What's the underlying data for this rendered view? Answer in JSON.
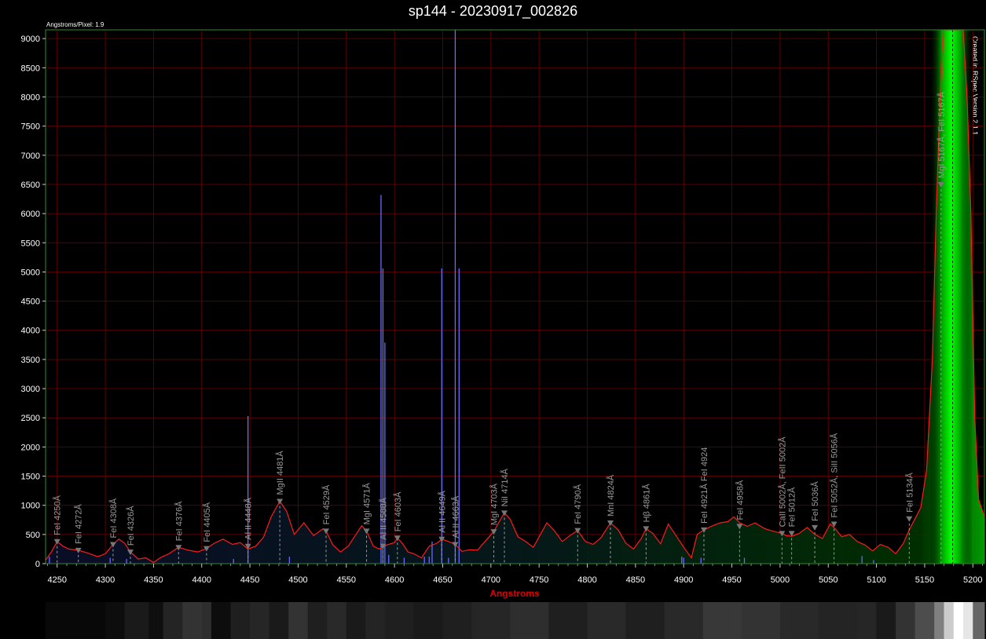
{
  "chart_data": {
    "type": "line",
    "title": "sp144 - 20230917_002826",
    "angstroms_per_pixel_note": "Angstroms/Pixel: 1.9",
    "software_note": "Created in RSpec Version 2.1.1",
    "xlabel": "Angstroms",
    "ylabel": "",
    "xlim": [
      4238,
      5212
    ],
    "ylim": [
      0,
      9150
    ],
    "grid": true,
    "x_ticks": [
      4250,
      4300,
      4350,
      4400,
      4450,
      4500,
      4550,
      4600,
      4650,
      4700,
      4750,
      4800,
      4850,
      4900,
      4950,
      5000,
      5050,
      5100,
      5150,
      5200
    ],
    "y_ticks": [
      0,
      500,
      1000,
      1500,
      2000,
      2500,
      3000,
      3500,
      4000,
      4500,
      5000,
      5500,
      6000,
      6500,
      7000,
      7500,
      8000,
      8500,
      9000
    ],
    "colors": {
      "spectrum": "#ff1a1a",
      "grid": "#5a0000",
      "frame": "#2c8a2c",
      "annotation": "#9a9a9a",
      "marker": "#777777",
      "raw_lines": "#6a6aff",
      "emission_glow": "#00ff00"
    },
    "series": [
      {
        "x": [
          4238,
          4244,
          4250,
          4256,
          4262,
          4272,
          4282,
          4292,
          4300,
          4308,
          4314,
          4320,
          4326,
          4334,
          4342,
          4350,
          4358,
          4366,
          4376,
          4386,
          4396,
          4405,
          4413,
          4422,
          4432,
          4440,
          4448,
          4456,
          4464,
          4472,
          4481,
          4488,
          4496,
          4506,
          4516,
          4526,
          4529,
          4536,
          4544,
          4552,
          4560,
          4566,
          4571,
          4578,
          4584,
          4592,
          4600,
          4603,
          4608,
          4614,
          4620,
          4628,
          4636,
          4644,
          4649,
          4656,
          4663,
          4670,
          4678,
          4686,
          4696,
          4703,
          4708,
          4714,
          4720,
          4728,
          4736,
          4744,
          4750,
          4758,
          4766,
          4774,
          4782,
          4790,
          4798,
          4806,
          4814,
          4824,
          4832,
          4840,
          4848,
          4856,
          4861,
          4868,
          4876,
          4884,
          4892,
          4900,
          4908,
          4914,
          4921,
          4930,
          4938,
          4946,
          4952,
          4958,
          4966,
          4974,
          4984,
          4994,
          5002,
          5006,
          5012,
          5020,
          5028,
          5036,
          5044,
          5052,
          5056,
          5064,
          5072,
          5080,
          5088,
          5096,
          5104,
          5112,
          5120,
          5128,
          5134,
          5140,
          5146,
          5152,
          5158,
          5162,
          5166,
          5170,
          5174,
          5178,
          5182,
          5186,
          5190,
          5194,
          5198,
          5202,
          5206,
          5212
        ],
        "y": [
          60,
          200,
          380,
          300,
          250,
          230,
          180,
          120,
          170,
          330,
          420,
          350,
          200,
          80,
          100,
          20,
          110,
          170,
          280,
          230,
          200,
          260,
          350,
          420,
          330,
          360,
          250,
          300,
          450,
          800,
          1070,
          900,
          500,
          700,
          480,
          600,
          560,
          320,
          200,
          300,
          500,
          650,
          560,
          300,
          250,
          320,
          360,
          440,
          350,
          200,
          170,
          100,
          300,
          350,
          420,
          380,
          330,
          210,
          240,
          230,
          420,
          550,
          700,
          870,
          760,
          460,
          380,
          280,
          460,
          700,
          560,
          380,
          480,
          570,
          380,
          330,
          440,
          700,
          580,
          350,
          250,
          430,
          600,
          520,
          340,
          680,
          480,
          280,
          100,
          500,
          580,
          650,
          700,
          720,
          800,
          700,
          640,
          700,
          600,
          550,
          520,
          480,
          470,
          520,
          620,
          500,
          430,
          680,
          620,
          460,
          500,
          380,
          320,
          220,
          330,
          280,
          170,
          350,
          580,
          770,
          960,
          1600,
          3500,
          6000,
          8000,
          9150,
          9150,
          9150,
          9150,
          9150,
          9150,
          8000,
          6000,
          2500,
          1100,
          800
        ],
        "glow_range": [
          5155,
          5200
        ]
      }
    ],
    "raw_lines": [
      {
        "x": 4242,
        "h": 120
      },
      {
        "x": 4305,
        "h": 100
      },
      {
        "x": 4322,
        "h": 80
      },
      {
        "x": 4433,
        "h": 80
      },
      {
        "x": 4448,
        "h": 2530
      },
      {
        "x": 4491,
        "h": 120
      },
      {
        "x": 4586,
        "h": 6320
      },
      {
        "x": 4588,
        "h": 5060
      },
      {
        "x": 4590,
        "h": 3790
      },
      {
        "x": 4594,
        "h": 150
      },
      {
        "x": 4610,
        "h": 100
      },
      {
        "x": 4631,
        "h": 120
      },
      {
        "x": 4636,
        "h": 120
      },
      {
        "x": 4639,
        "h": 380
      },
      {
        "x": 4649,
        "h": 5060
      },
      {
        "x": 4656,
        "h": 100
      },
      {
        "x": 4663,
        "h": 9150
      },
      {
        "x": 4667,
        "h": 5060
      },
      {
        "x": 4898,
        "h": 120
      },
      {
        "x": 4900,
        "h": 100
      },
      {
        "x": 4918,
        "h": 100
      },
      {
        "x": 4963,
        "h": 100
      },
      {
        "x": 5085,
        "h": 130
      },
      {
        "x": 5097,
        "h": 60
      }
    ],
    "annotations": [
      {
        "x": 4250,
        "y": 380,
        "label": "FeI 4250Å"
      },
      {
        "x": 4272,
        "y": 230,
        "label": "FeI 4272Å"
      },
      {
        "x": 4308,
        "y": 330,
        "label": "FeI 4308Å"
      },
      {
        "x": 4326,
        "y": 200,
        "label": "FeI 4326Å"
      },
      {
        "x": 4376,
        "y": 280,
        "label": "FeI 4376Å"
      },
      {
        "x": 4405,
        "y": 260,
        "label": "FeI 4405Å"
      },
      {
        "x": 4448,
        "y": 300,
        "label": "Al II 4448Å"
      },
      {
        "x": 4481,
        "y": 1070,
        "label": "MgII 4481Å"
      },
      {
        "x": 4529,
        "y": 560,
        "label": "FeI 4529Å"
      },
      {
        "x": 4571,
        "y": 560,
        "label": "MgI 4571Å"
      },
      {
        "x": 4588,
        "y": 300,
        "label": "Al II 4588Å"
      },
      {
        "x": 4603,
        "y": 440,
        "label": "FeI 4603Å"
      },
      {
        "x": 4649,
        "y": 420,
        "label": "Al II 4649Å"
      },
      {
        "x": 4663,
        "y": 330,
        "label": "Al II 4663Å"
      },
      {
        "x": 4703,
        "y": 550,
        "label": "MgI 4703Å"
      },
      {
        "x": 4714,
        "y": 870,
        "label": "NiI 4714Å"
      },
      {
        "x": 4790,
        "y": 570,
        "label": "FeI 4790Å"
      },
      {
        "x": 4824,
        "y": 700,
        "label": "MnI 4824Å"
      },
      {
        "x": 4861,
        "y": 600,
        "label": "Hβ 4861Å"
      },
      {
        "x": 4921,
        "y": 580,
        "label": "FeI 4921Å FeI 4924"
      },
      {
        "x": 4958,
        "y": 640,
        "label": "FeI 4958Å"
      },
      {
        "x": 5002,
        "y": 520,
        "label": "CaII 5002Å, FeII 5002Å"
      },
      {
        "x": 5012,
        "y": 520,
        "label": "FeI 5012Å"
      },
      {
        "x": 5036,
        "y": 620,
        "label": "FeI 5036Å"
      },
      {
        "x": 5056,
        "y": 680,
        "label": "FeI 5052Å, SiII 5056Å"
      },
      {
        "x": 5134,
        "y": 770,
        "label": "FeI 5134Å"
      },
      {
        "x": 5167,
        "y": 6500,
        "label": "MgI 5167Å, FeI 5167Å"
      }
    ],
    "spectrum_strip": {
      "x": [
        4238,
        4300,
        4320,
        4345,
        4360,
        4380,
        4400,
        4410,
        4430,
        4450,
        4470,
        4490,
        4510,
        4530,
        4550,
        4570,
        4590,
        4620,
        4650,
        4680,
        4720,
        4760,
        4800,
        4840,
        4880,
        4920,
        4960,
        5000,
        5040,
        5080,
        5100,
        5120,
        5140,
        5160,
        5170,
        5180,
        5186,
        5190,
        5200,
        5212
      ],
      "b": [
        0.03,
        0.05,
        0.1,
        0.06,
        0.14,
        0.2,
        0.18,
        0.05,
        0.12,
        0.15,
        0.1,
        0.2,
        0.12,
        0.16,
        0.1,
        0.14,
        0.12,
        0.1,
        0.12,
        0.15,
        0.18,
        0.12,
        0.16,
        0.12,
        0.16,
        0.22,
        0.2,
        0.16,
        0.14,
        0.15,
        0.1,
        0.2,
        0.3,
        0.5,
        0.8,
        1.0,
        1.0,
        0.9,
        0.4,
        0.1
      ]
    }
  }
}
